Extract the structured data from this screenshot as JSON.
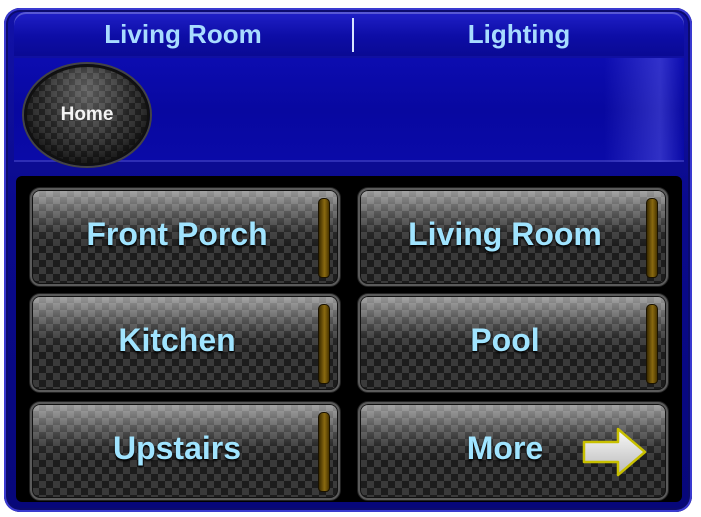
{
  "header": {
    "room": "Living Room",
    "category": "Lighting"
  },
  "home_button": {
    "label": "Home"
  },
  "buttons": [
    {
      "label": "Front Porch"
    },
    {
      "label": "Living Room"
    },
    {
      "label": "Kitchen"
    },
    {
      "label": "Pool"
    },
    {
      "label": "Upstairs"
    },
    {
      "label": "More",
      "icon": "right-arrow-icon"
    }
  ],
  "colors": {
    "frame_blue": "#0a0a8c",
    "label_cyan": "#a0e4ff",
    "indicator_amber": "#8a6a10"
  }
}
